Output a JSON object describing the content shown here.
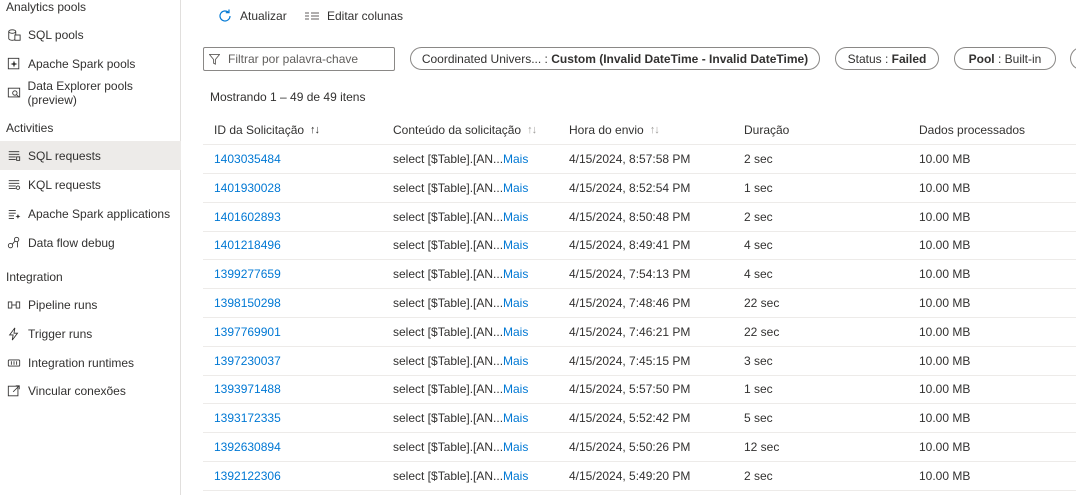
{
  "sidebar": {
    "sections": [
      {
        "label": "Analytics pools"
      },
      {
        "label": "Activities"
      },
      {
        "label": "Integration"
      }
    ],
    "items": [
      {
        "label": "SQL pools",
        "icon": "sql-pool-icon"
      },
      {
        "label": "Apache Spark pools",
        "icon": "spark-pool-icon"
      },
      {
        "label": "Data Explorer pools (preview)",
        "icon": "data-explorer-icon"
      },
      {
        "label": "SQL requests",
        "icon": "sql-requests-icon",
        "active": true
      },
      {
        "label": "KQL requests",
        "icon": "kql-requests-icon"
      },
      {
        "label": "Apache Spark applications",
        "icon": "spark-app-icon"
      },
      {
        "label": "Data flow debug",
        "icon": "data-flow-icon"
      },
      {
        "label": "Pipeline runs",
        "icon": "pipeline-icon"
      },
      {
        "label": "Trigger runs",
        "icon": "trigger-icon"
      },
      {
        "label": "Integration runtimes",
        "icon": "runtime-icon"
      },
      {
        "label": "Vincular conexões",
        "icon": "link-connections-icon"
      }
    ]
  },
  "toolbar": {
    "refresh_label": "Atualizar",
    "edit_columns_label": "Editar colunas"
  },
  "filters": {
    "search_placeholder": "Filtrar por palavra-chave",
    "time_key": "Coordinated Univers...",
    "time_sep": " : ",
    "time_value": "Custom (Invalid DateTime - Invalid DateTime)",
    "status_key": "Status",
    "status_sep": " : ",
    "status_value": "Failed",
    "pool_key": "Pool",
    "pool_sep": " : ",
    "pool_value": "Built-in"
  },
  "showing_text": "Mostrando 1 – 49 de 49 itens",
  "table": {
    "columns": [
      "ID da Solicitação",
      "Conteúdo da solicitação",
      "Hora do envio",
      "Duração",
      "Dados processados"
    ],
    "sort_glyph": "↑↓",
    "more_label": "Mais",
    "rows": [
      {
        "id": "1403035484",
        "content": "select [$Table].[AN...",
        "time": "4/15/2024, 8:57:58 PM",
        "duration": "2 sec",
        "data": "10.00 MB"
      },
      {
        "id": "1401930028",
        "content": "select [$Table].[AN...",
        "time": "4/15/2024, 8:52:54 PM",
        "duration": "1 sec",
        "data": "10.00 MB"
      },
      {
        "id": "1401602893",
        "content": "select [$Table].[AN...",
        "time": "4/15/2024, 8:50:48 PM",
        "duration": "2 sec",
        "data": "10.00 MB"
      },
      {
        "id": "1401218496",
        "content": "select [$Table].[AN...",
        "time": "4/15/2024, 8:49:41 PM",
        "duration": "4 sec",
        "data": "10.00 MB"
      },
      {
        "id": "1399277659",
        "content": "select [$Table].[AN...",
        "time": "4/15/2024, 7:54:13 PM",
        "duration": "4 sec",
        "data": "10.00 MB"
      },
      {
        "id": "1398150298",
        "content": "select [$Table].[AN...",
        "time": "4/15/2024, 7:48:46 PM",
        "duration": "22 sec",
        "data": "10.00 MB"
      },
      {
        "id": "1397769901",
        "content": "select [$Table].[AN...",
        "time": "4/15/2024, 7:46:21 PM",
        "duration": "22 sec",
        "data": "10.00 MB"
      },
      {
        "id": "1397230037",
        "content": "select [$Table].[AN...",
        "time": "4/15/2024, 7:45:15 PM",
        "duration": "3 sec",
        "data": "10.00 MB"
      },
      {
        "id": "1393971488",
        "content": "select [$Table].[AN...",
        "time": "4/15/2024, 5:57:50 PM",
        "duration": "1 sec",
        "data": "10.00 MB"
      },
      {
        "id": "1393172335",
        "content": "select [$Table].[AN...",
        "time": "4/15/2024, 5:52:42 PM",
        "duration": "5 sec",
        "data": "10.00 MB"
      },
      {
        "id": "1392630894",
        "content": "select [$Table].[AN...",
        "time": "4/15/2024, 5:50:26 PM",
        "duration": "12 sec",
        "data": "10.00 MB"
      },
      {
        "id": "1392122306",
        "content": "select [$Table].[AN...",
        "time": "4/15/2024, 5:49:20 PM",
        "duration": "2 sec",
        "data": "10.00 MB"
      }
    ]
  },
  "colors": {
    "link": "#0078d4",
    "active_bg": "#edebe9",
    "border": "#8a8886"
  }
}
